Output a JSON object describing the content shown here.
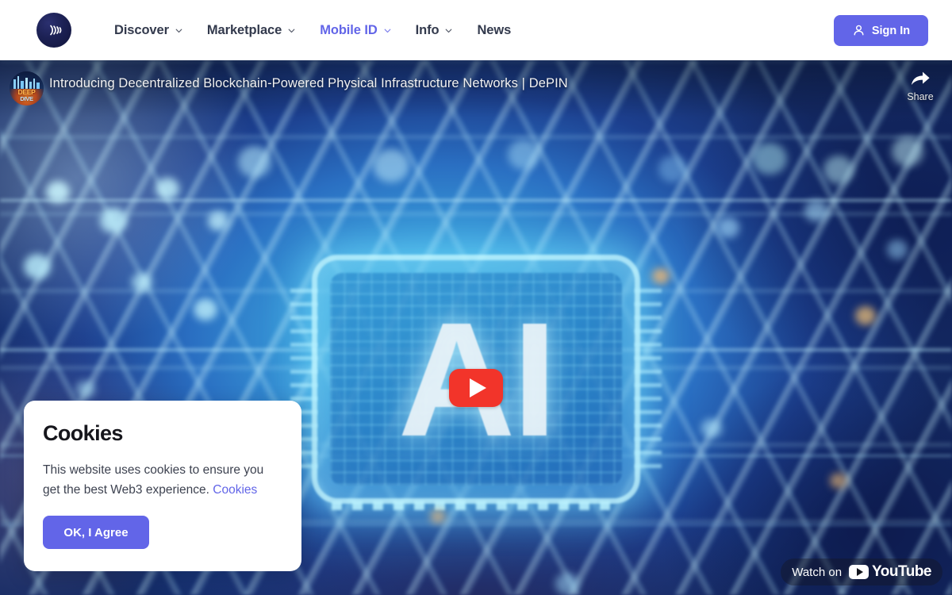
{
  "header": {
    "logo_icon": "contactless-wave-logo",
    "nav": [
      {
        "label": "Discover",
        "has_chevron": true,
        "active": false
      },
      {
        "label": "Marketplace",
        "has_chevron": true,
        "active": false
      },
      {
        "label": "Mobile ID",
        "has_chevron": true,
        "active": true
      },
      {
        "label": "Info",
        "has_chevron": true,
        "active": false
      },
      {
        "label": "News",
        "has_chevron": false,
        "active": false
      }
    ],
    "signin_label": "Sign In",
    "signin_icon": "person-icon",
    "accent_color": "#6265e8",
    "nav_text_color": "#333a4d"
  },
  "video": {
    "title": "Introducing Decentralized Blockchain-Powered Physical Infrastructure Networks | DePIN",
    "channel_avatar_line1": "DEEP",
    "channel_avatar_line2": "DIVE",
    "share_label": "Share",
    "share_icon": "share-arrow-icon",
    "play_icon": "youtube-play-icon",
    "play_color": "#f2342a",
    "watch_label": "Watch on",
    "youtube_word": "YouTube",
    "thumbnail_text": "AI"
  },
  "cookies": {
    "title": "Cookies",
    "body_part1": "This website uses cookies to ensure you get the best Web3 experience. ",
    "link_label": "Cookies",
    "accept_label": "OK, I Agree",
    "accent_color": "#6265e8"
  }
}
